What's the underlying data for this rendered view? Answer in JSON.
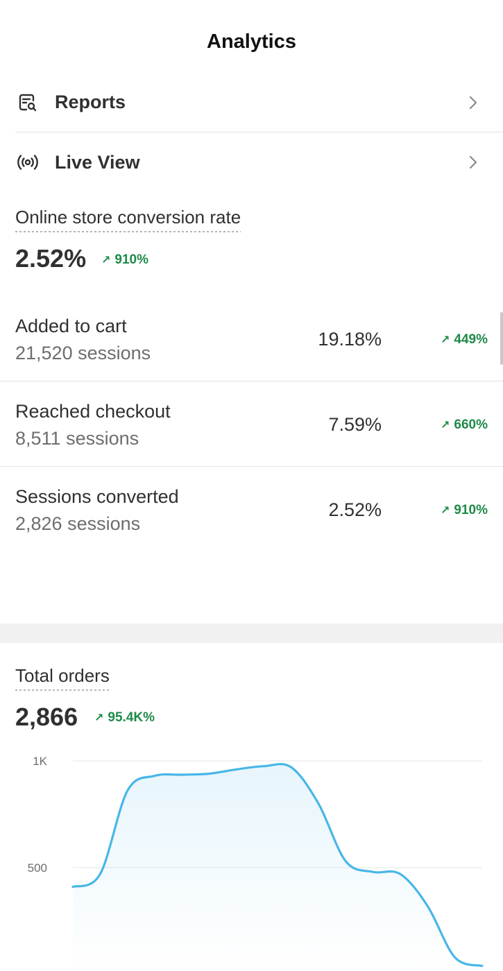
{
  "header": {
    "title": "Analytics"
  },
  "nav": {
    "items": [
      {
        "label": "Reports",
        "icon": "report-search-icon"
      },
      {
        "label": "Live View",
        "icon": "live-broadcast-icon"
      }
    ]
  },
  "conversion": {
    "title": "Online store conversion rate",
    "value": "2.52%",
    "change": "910%",
    "change_arrow": "↗"
  },
  "funnel": [
    {
      "name": "Added to cart",
      "sessions": "21,520 sessions",
      "rate": "19.18%",
      "change": "449%"
    },
    {
      "name": "Reached checkout",
      "sessions": "8,511 sessions",
      "rate": "7.59%",
      "change": "660%"
    },
    {
      "name": "Sessions converted",
      "sessions": "2,826 sessions",
      "rate": "2.52%",
      "change": "910%"
    }
  ],
  "orders": {
    "title": "Total orders",
    "value": "2,866",
    "change": "95.4K%",
    "change_arrow": "↗"
  },
  "colors": {
    "positive": "#1e8a48",
    "line": "#47b6e8",
    "text": "#303030",
    "muted": "#6d6d6d"
  },
  "chart_data": {
    "type": "area",
    "title": "Total orders",
    "y_ticks": [
      "1K",
      "500"
    ],
    "ylim": [
      0,
      1000
    ],
    "grid": true,
    "series": [
      {
        "values": [
          410,
          470,
          860,
          930,
          935,
          940,
          960,
          975,
          970,
          800,
          530,
          480,
          470,
          320,
          80,
          40
        ]
      }
    ]
  }
}
